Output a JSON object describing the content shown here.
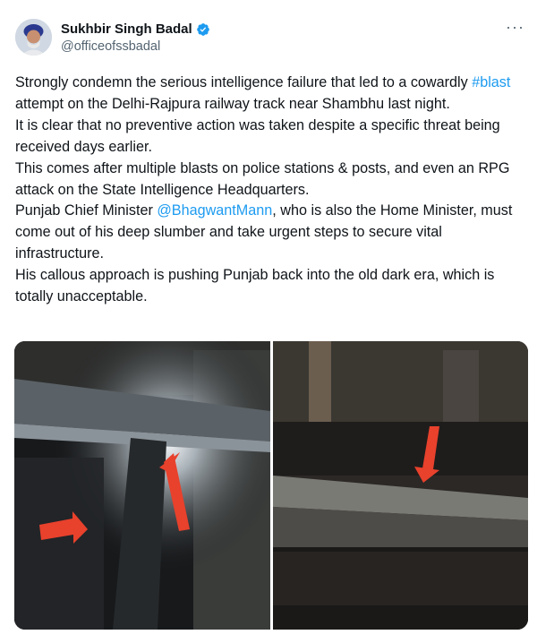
{
  "author": {
    "name": "Sukhbir Singh Badal",
    "handle": "@officeofssbadal",
    "verified_icon": "verified-badge-icon"
  },
  "menu": {
    "more_label": "···"
  },
  "tweet": {
    "line1_pre": "Strongly condemn the serious intelligence failure that led to a cowardly ",
    "hashtag": "#blast",
    "line1_post": " attempt on the Delhi-Rajpura railway track near Shambhu last night.",
    "line2": "It is clear that no preventive action was taken despite a specific threat being received days earlier.",
    "line3": "This comes after multiple blasts on police stations & posts, and even an RPG attack on the State Intelligence Headquarters.",
    "line4_pre": "Punjab Chief Minister ",
    "mention": "@BhagwantMann",
    "line4_post": ", who is also the Home Minister, must come out of his deep slumber and take urgent steps to secure vital infrastructure.",
    "line5": "His callous approach is pushing Punjab back into the old dark era, which is totally unacceptable."
  },
  "colors": {
    "link": "#1d9bf0",
    "arrow": "#e8412c",
    "verified": "#1d9bf0"
  }
}
